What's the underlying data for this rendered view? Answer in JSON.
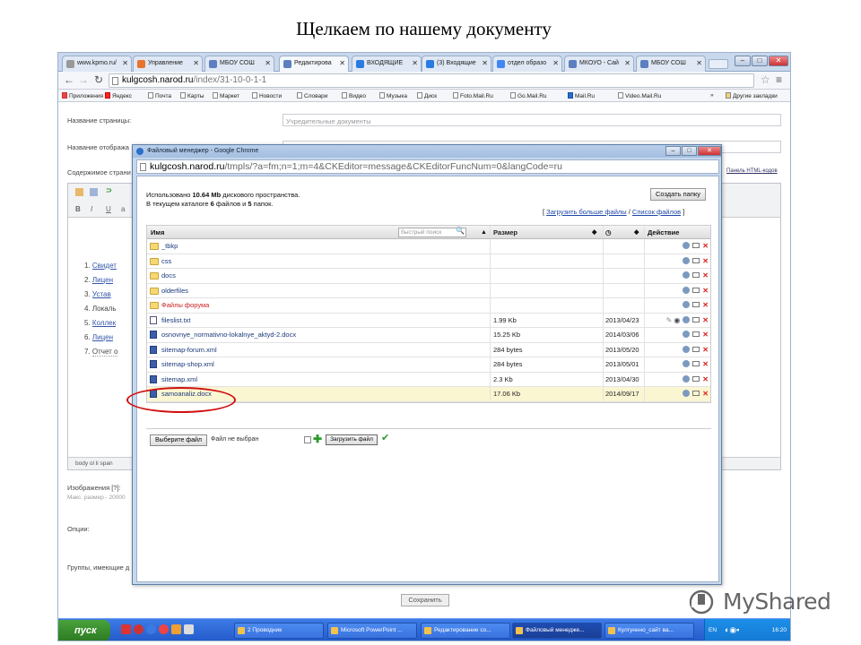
{
  "slide": {
    "title": "Щелкаем по нашему документу"
  },
  "browser": {
    "tabs": [
      {
        "label": "www.kpmo.ru/",
        "icon": "page-icon"
      },
      {
        "label": "Управление",
        "icon": "fire-icon"
      },
      {
        "label": "МБОУ СОШ",
        "icon": "diamond-icon"
      },
      {
        "label": "Редактирова",
        "icon": "diamond-icon",
        "active": true
      },
      {
        "label": "ВХОДЯЩИЕ",
        "icon": "mail-icon"
      },
      {
        "label": "(3) Входящие",
        "icon": "mail-icon"
      },
      {
        "label": "отдел образо",
        "icon": "google-icon"
      },
      {
        "label": "МКОУО - Сай",
        "icon": "diamond-icon"
      },
      {
        "label": "МБОУ СОШ",
        "icon": "diamond-icon"
      }
    ],
    "url": {
      "host": "kulgcosh.narod.ru",
      "path": "/index/31-10-0-1-1"
    },
    "bookmarks": [
      "Приложения",
      "Яндекс",
      "Почта",
      "Карты",
      "Маркет",
      "Новости",
      "Словари",
      "Видео",
      "Музыка",
      "Диск",
      "Foto.Mail.Ru",
      "Go.Mail.Ru",
      "Mail.Ru",
      "Video.Mail.Ru"
    ],
    "bookmarks_more": "»",
    "other_bookmarks": "Другие закладки"
  },
  "page": {
    "fields": {
      "page_name_label": "Название страницы:",
      "page_name_value": "Учредительные документы",
      "display_name_label": "Название отобража",
      "content_label": "Содержимое страни",
      "html_panel_link": "Панель HTML-кодов"
    },
    "editor": {
      "toolbar_row2": [
        "B",
        "I",
        "U",
        "a"
      ],
      "list": [
        {
          "num": "1.",
          "text": "Свидет"
        },
        {
          "num": "2.",
          "text": "Лицен"
        },
        {
          "num": "3.",
          "text": "Устав"
        },
        {
          "num": "4.",
          "text": "Локаль"
        },
        {
          "num": "5.",
          "text": "Коллек"
        },
        {
          "num": "6.",
          "text": "Лицен"
        },
        {
          "num": "7.",
          "text": "Отчет о"
        }
      ],
      "statusbar": "body  ol  li  span"
    },
    "images_label": "Изображения [?]:",
    "images_note": "Макс. размер - 20000",
    "options_label": "Опции:",
    "groups_label": "Группы, имеющие д",
    "save_button": "Сохранить"
  },
  "dialog": {
    "title": "Файловый менеджер - Google Chrome",
    "url": {
      "host": "kulgcosh.narod.ru",
      "path": "/tmpls/?a=fm;n=1;m=4&CKEditor=message&CKEditorFuncNum=0&langCode=ru"
    },
    "usage_pre": "Использовано ",
    "usage_value": "10.64 Mb",
    "usage_post": " дискового пространства.",
    "count_pre": "В текущем каталоге ",
    "count_files": "6",
    "count_mid": " файлов и ",
    "count_folders": "5",
    "count_post": " папок.",
    "new_folder_button": "Создать папку",
    "more_files_link": "Загрузить больше файлы",
    "file_list_link": "Список файлов",
    "columns": {
      "name": "Имя",
      "search_placeholder": "быстрый поиск",
      "size": "Размер",
      "action": "Действие"
    },
    "rows": [
      {
        "type": "folder",
        "name": "_tbkp",
        "size": "",
        "date": ""
      },
      {
        "type": "folder",
        "name": "css",
        "size": "",
        "date": ""
      },
      {
        "type": "folder",
        "name": "docs",
        "size": "",
        "date": ""
      },
      {
        "type": "folder",
        "name": "olderfiles",
        "size": "",
        "date": ""
      },
      {
        "type": "folder",
        "name": "Файлы форума",
        "size": "",
        "date": "",
        "red": true
      },
      {
        "type": "file",
        "name": "fileslist.txt",
        "size": "1.99 Kb",
        "date": "2013/04/23",
        "extra": true
      },
      {
        "type": "doc",
        "name": "osnovnye_normativno-lokalnye_aktyd-2.docx",
        "size": "15.25 Kb",
        "date": "2014/03/06"
      },
      {
        "type": "doc",
        "name": "sitemap-forum.xml",
        "size": "284 bytes",
        "date": "2013/05/20"
      },
      {
        "type": "doc",
        "name": "sitemap-shop.xml",
        "size": "284 bytes",
        "date": "2013/05/01"
      },
      {
        "type": "doc",
        "name": "sitemap.xml",
        "size": "2.3 Kb",
        "date": "2013/04/30"
      },
      {
        "type": "doc",
        "name": "samoanaliz.docx",
        "size": "17.06 Kb",
        "date": "2014/09/17",
        "selected": true
      }
    ],
    "choose_file_button": "Выберите файл",
    "no_file_text": "Файл не выбран",
    "upload_button": "Загрузить файл"
  },
  "taskbar": {
    "start": "пуск",
    "tasks": [
      "2 Проводник",
      "Microsoft PowerPoint ...",
      "Редактирование со...",
      "Файловый менедже...",
      "Кулгуннно_сайт ва..."
    ],
    "lang": "EN",
    "clock": "16:20"
  },
  "watermark": {
    "text": "MyShared"
  },
  "colors": {
    "accent_red": "#d01010",
    "link_blue": "#1f47a8",
    "taskbar_blue": "#2259c9"
  }
}
